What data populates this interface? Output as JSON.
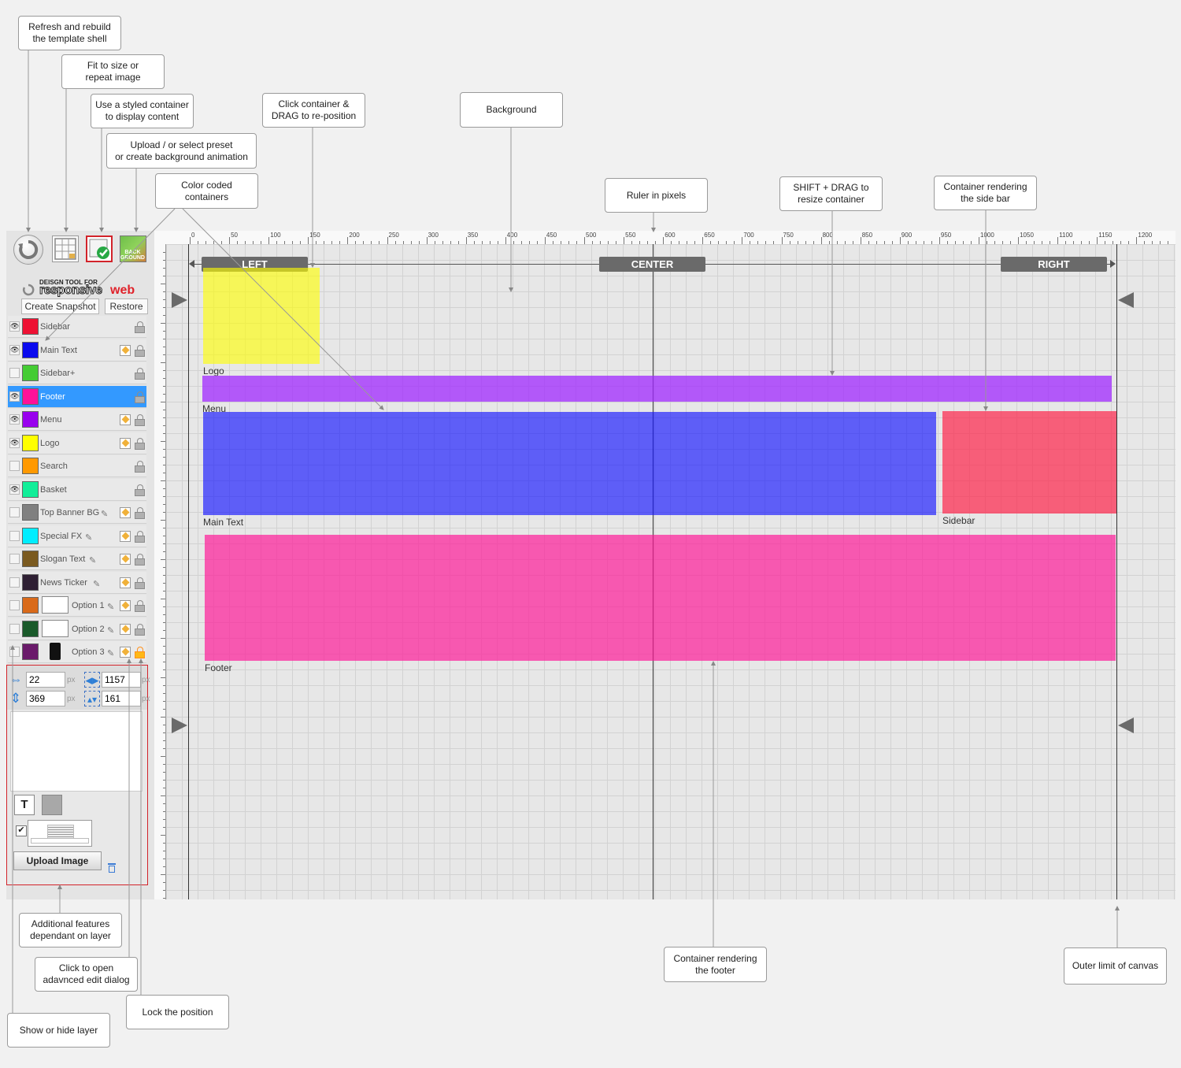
{
  "callouts": {
    "refresh": "Refresh and rebuild\nthe template shell",
    "fit": "Fit to size or\nrepeat image",
    "styled": "Use a styled container\nto display content",
    "upload_bg": "Upload / or select preset\nor create background animation",
    "color_coded": "Color coded\ncontainers",
    "click_drag": "Click container &\nDRAG to re-position",
    "background": "Background",
    "ruler": "Ruler in pixels",
    "shift_drag": "SHIFT + DRAG to\nresize container",
    "sidebar_render": "Container rendering\nthe side bar",
    "additional": "Additional features\ndependant on layer",
    "advanced": "Click to open\nadavnced edit dialog",
    "lock": "Lock the position",
    "show_hide": "Show or hide layer",
    "footer_render": "Container rendering\nthe footer",
    "outer_limit": "Outer limit of canvas"
  },
  "toolbar": {
    "refresh_icon": "refresh-icon",
    "fit_icon": "grid-fit-icon",
    "styled_icon": "styled-container-icon",
    "background_label": "BACK\nGROUND"
  },
  "brand": {
    "tagline": "DEISGN TOOL FOR",
    "word1": "responsive",
    "word2": "web"
  },
  "snapshot": {
    "create": "Create Snapshot",
    "restore": "Restore"
  },
  "layers": [
    {
      "name": "Sidebar",
      "color": "#ee1133",
      "visible": true,
      "edit": false
    },
    {
      "name": "Main Text",
      "color": "#0a0aee",
      "visible": true,
      "edit": true
    },
    {
      "name": "Sidebar+",
      "color": "#44cc33",
      "visible": false,
      "edit": false
    },
    {
      "name": "Footer",
      "color": "#ff1199",
      "visible": true,
      "edit": false,
      "selected": true
    },
    {
      "name": "Menu",
      "color": "#9900ee",
      "visible": true,
      "edit": true
    },
    {
      "name": "Logo",
      "color": "#ffff00",
      "visible": true,
      "edit": true
    },
    {
      "name": "Search",
      "color": "#ff9900",
      "visible": false,
      "edit": false
    },
    {
      "name": "Basket",
      "color": "#11ee99",
      "visible": true,
      "edit": false
    },
    {
      "name": "Top Banner BG",
      "color": "#808080",
      "visible": false,
      "edit": true,
      "pencil": true
    },
    {
      "name": "Special FX",
      "color": "#00eeff",
      "visible": false,
      "edit": true,
      "pencil": true
    },
    {
      "name": "Slogan Text",
      "color": "#7a5a20",
      "visible": false,
      "edit": true,
      "pencil": true
    },
    {
      "name": "News Ticker",
      "color": "#2e1f33",
      "visible": false,
      "edit": true,
      "pencil": true
    },
    {
      "name": "Option 1",
      "color": "#d96a1a",
      "visible": false,
      "edit": true,
      "pencil": true,
      "device": "desktop"
    },
    {
      "name": "Option 2",
      "color": "#1a5a2a",
      "visible": false,
      "edit": true,
      "pencil": true,
      "device": "tablet"
    },
    {
      "name": "Option 3",
      "color": "#6a1a6a",
      "visible": false,
      "edit": true,
      "pencil": true,
      "device": "phone",
      "lock_active": true
    }
  ],
  "props": {
    "x": "22",
    "y": "369",
    "width": "1157",
    "height": "161",
    "unit": "px",
    "upload_label": "Upload Image",
    "text_icon": "text-style-icon",
    "trash_icon": "trash-icon"
  },
  "ruler": {
    "ticks": [
      "0",
      "50",
      "100",
      "150",
      "200",
      "250",
      "300",
      "350",
      "400",
      "450",
      "500",
      "550",
      "600",
      "650",
      "700",
      "750",
      "800",
      "850",
      "900",
      "950",
      "1000",
      "1050",
      "1100",
      "1150",
      "1200"
    ]
  },
  "zones": {
    "left": "LEFT",
    "center": "CENTER",
    "right": "RIGHT"
  },
  "blocks": [
    {
      "name": "Logo",
      "color": "rgba(255,255,0,0.62)"
    },
    {
      "name": "Menu",
      "color": "rgba(160,40,255,0.75)"
    },
    {
      "name": "Main Text",
      "color": "rgba(20,20,255,0.65)"
    },
    {
      "name": "Sidebar",
      "color": "rgba(255,30,70,0.68)"
    },
    {
      "name": "Footer",
      "color": "rgba(255,20,150,0.68)"
    }
  ]
}
